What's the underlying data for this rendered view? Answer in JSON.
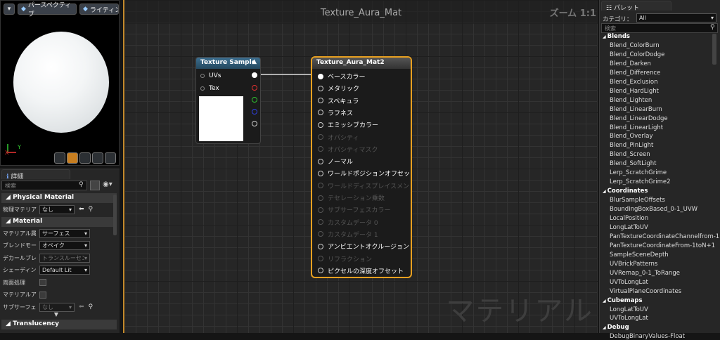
{
  "viewport": {
    "perspective_label": "パースペクティブ",
    "lighting_label": "ライティング",
    "axis_y": "Y",
    "axis_x": "X"
  },
  "details": {
    "tab_label": "詳細",
    "search_placeholder": "検索",
    "sections": [
      {
        "title": "Physical Material"
      },
      {
        "title": "Material"
      },
      {
        "title": "Translucency"
      }
    ],
    "physical_material": {
      "label": "物理マテリア",
      "value": "なし"
    },
    "material_props": [
      {
        "label": "マテリアル属",
        "value": "サーフェス",
        "type": "dropdown"
      },
      {
        "label": "ブレンドモー",
        "value": "オペイク",
        "type": "dropdown"
      },
      {
        "label": "デカールブレ",
        "value": "トランスルーセント",
        "type": "dropdown-disabled"
      },
      {
        "label": "シェーディン",
        "value": "Default Lit",
        "type": "dropdown"
      },
      {
        "label": "両面処理",
        "value": "",
        "type": "checkbox"
      },
      {
        "label": "マテリアルア",
        "value": "",
        "type": "checkbox"
      },
      {
        "label": "サブサーフェ",
        "value": "なし",
        "type": "dropdown-disabled"
      }
    ]
  },
  "graph": {
    "title": "Texture_Aura_Mat",
    "zoom": "ズーム 1:1",
    "watermark": "マテリアル",
    "texture_node": {
      "title": "Texture Sample",
      "inputs": [
        "UVs",
        "Tex"
      ]
    },
    "material_node": {
      "title": "Texture_Aura_Mat2",
      "pins": [
        {
          "label": "ベースカラー",
          "enabled": true,
          "connected": true
        },
        {
          "label": "メタリック",
          "enabled": true,
          "connected": false
        },
        {
          "label": "スペキュラ",
          "enabled": true,
          "connected": false
        },
        {
          "label": "ラフネス",
          "enabled": true,
          "connected": false
        },
        {
          "label": "エミッシブカラー",
          "enabled": true,
          "connected": false
        },
        {
          "label": "オパシティ",
          "enabled": false,
          "connected": false
        },
        {
          "label": "オパシティマスク",
          "enabled": false,
          "connected": false
        },
        {
          "label": "ノーマル",
          "enabled": true,
          "connected": false
        },
        {
          "label": "ワールドポジションオフセット",
          "enabled": true,
          "connected": false
        },
        {
          "label": "ワールドディスプレイスメント",
          "enabled": false,
          "connected": false
        },
        {
          "label": "テセレーション乗数",
          "enabled": false,
          "connected": false
        },
        {
          "label": "サブサーフェスカラー",
          "enabled": false,
          "connected": false
        },
        {
          "label": "カスタムデータ 0",
          "enabled": false,
          "connected": false
        },
        {
          "label": "カスタムデータ 1",
          "enabled": false,
          "connected": false
        },
        {
          "label": "アンビエントオクルージョン",
          "enabled": true,
          "connected": false
        },
        {
          "label": "リフラクション",
          "enabled": false,
          "connected": false
        },
        {
          "label": "ピクセルの深度オフセット",
          "enabled": true,
          "connected": false
        }
      ]
    }
  },
  "palette": {
    "tab_label": "パレット",
    "category_label": "カテゴリ：",
    "category_value": "All",
    "search_placeholder": "検索",
    "entries": [
      {
        "text": "Blends",
        "cat": true
      },
      {
        "text": "Blend_ColorBurn"
      },
      {
        "text": "Blend_ColorDodge"
      },
      {
        "text": "Blend_Darken"
      },
      {
        "text": "Blend_Difference"
      },
      {
        "text": "Blend_Exclusion"
      },
      {
        "text": "Blend_HardLight"
      },
      {
        "text": "Blend_Lighten"
      },
      {
        "text": "Blend_LinearBurn"
      },
      {
        "text": "Blend_LinearDodge"
      },
      {
        "text": "Blend_LinearLight"
      },
      {
        "text": "Blend_Overlay"
      },
      {
        "text": "Blend_PinLight"
      },
      {
        "text": "Blend_Screen"
      },
      {
        "text": "Blend_SoftLight"
      },
      {
        "text": "Lerp_ScratchGrime"
      },
      {
        "text": "Lerp_ScratchGrime2"
      },
      {
        "text": "Coordinates",
        "cat": true
      },
      {
        "text": "BlurSampleOffsets"
      },
      {
        "text": "BoundingBoxBased_0-1_UVW"
      },
      {
        "text": "LocalPosition"
      },
      {
        "text": "LongLatToUV"
      },
      {
        "text": "PanTextureCoordinateChannelfrom-1"
      },
      {
        "text": "PanTextureCoordinateFrom-1toN+1"
      },
      {
        "text": "SampleSceneDepth"
      },
      {
        "text": "UVBrickPatterns"
      },
      {
        "text": "UVRemap_0-1_ToRange"
      },
      {
        "text": "UVToLongLat"
      },
      {
        "text": "VirtualPlaneCoordinates"
      },
      {
        "text": "Cubemaps",
        "cat": true
      },
      {
        "text": "LongLatToUV"
      },
      {
        "text": "UVToLongLat"
      },
      {
        "text": "Debug",
        "cat": true
      },
      {
        "text": "DebugBinaryValues-Float"
      }
    ]
  },
  "colors": {
    "accent_orange": "#c48a2c",
    "node_header_blue": "#3c6e8f",
    "pin_red": "#e03030",
    "pin_green": "#30c030",
    "pin_blue": "#3040e0"
  }
}
